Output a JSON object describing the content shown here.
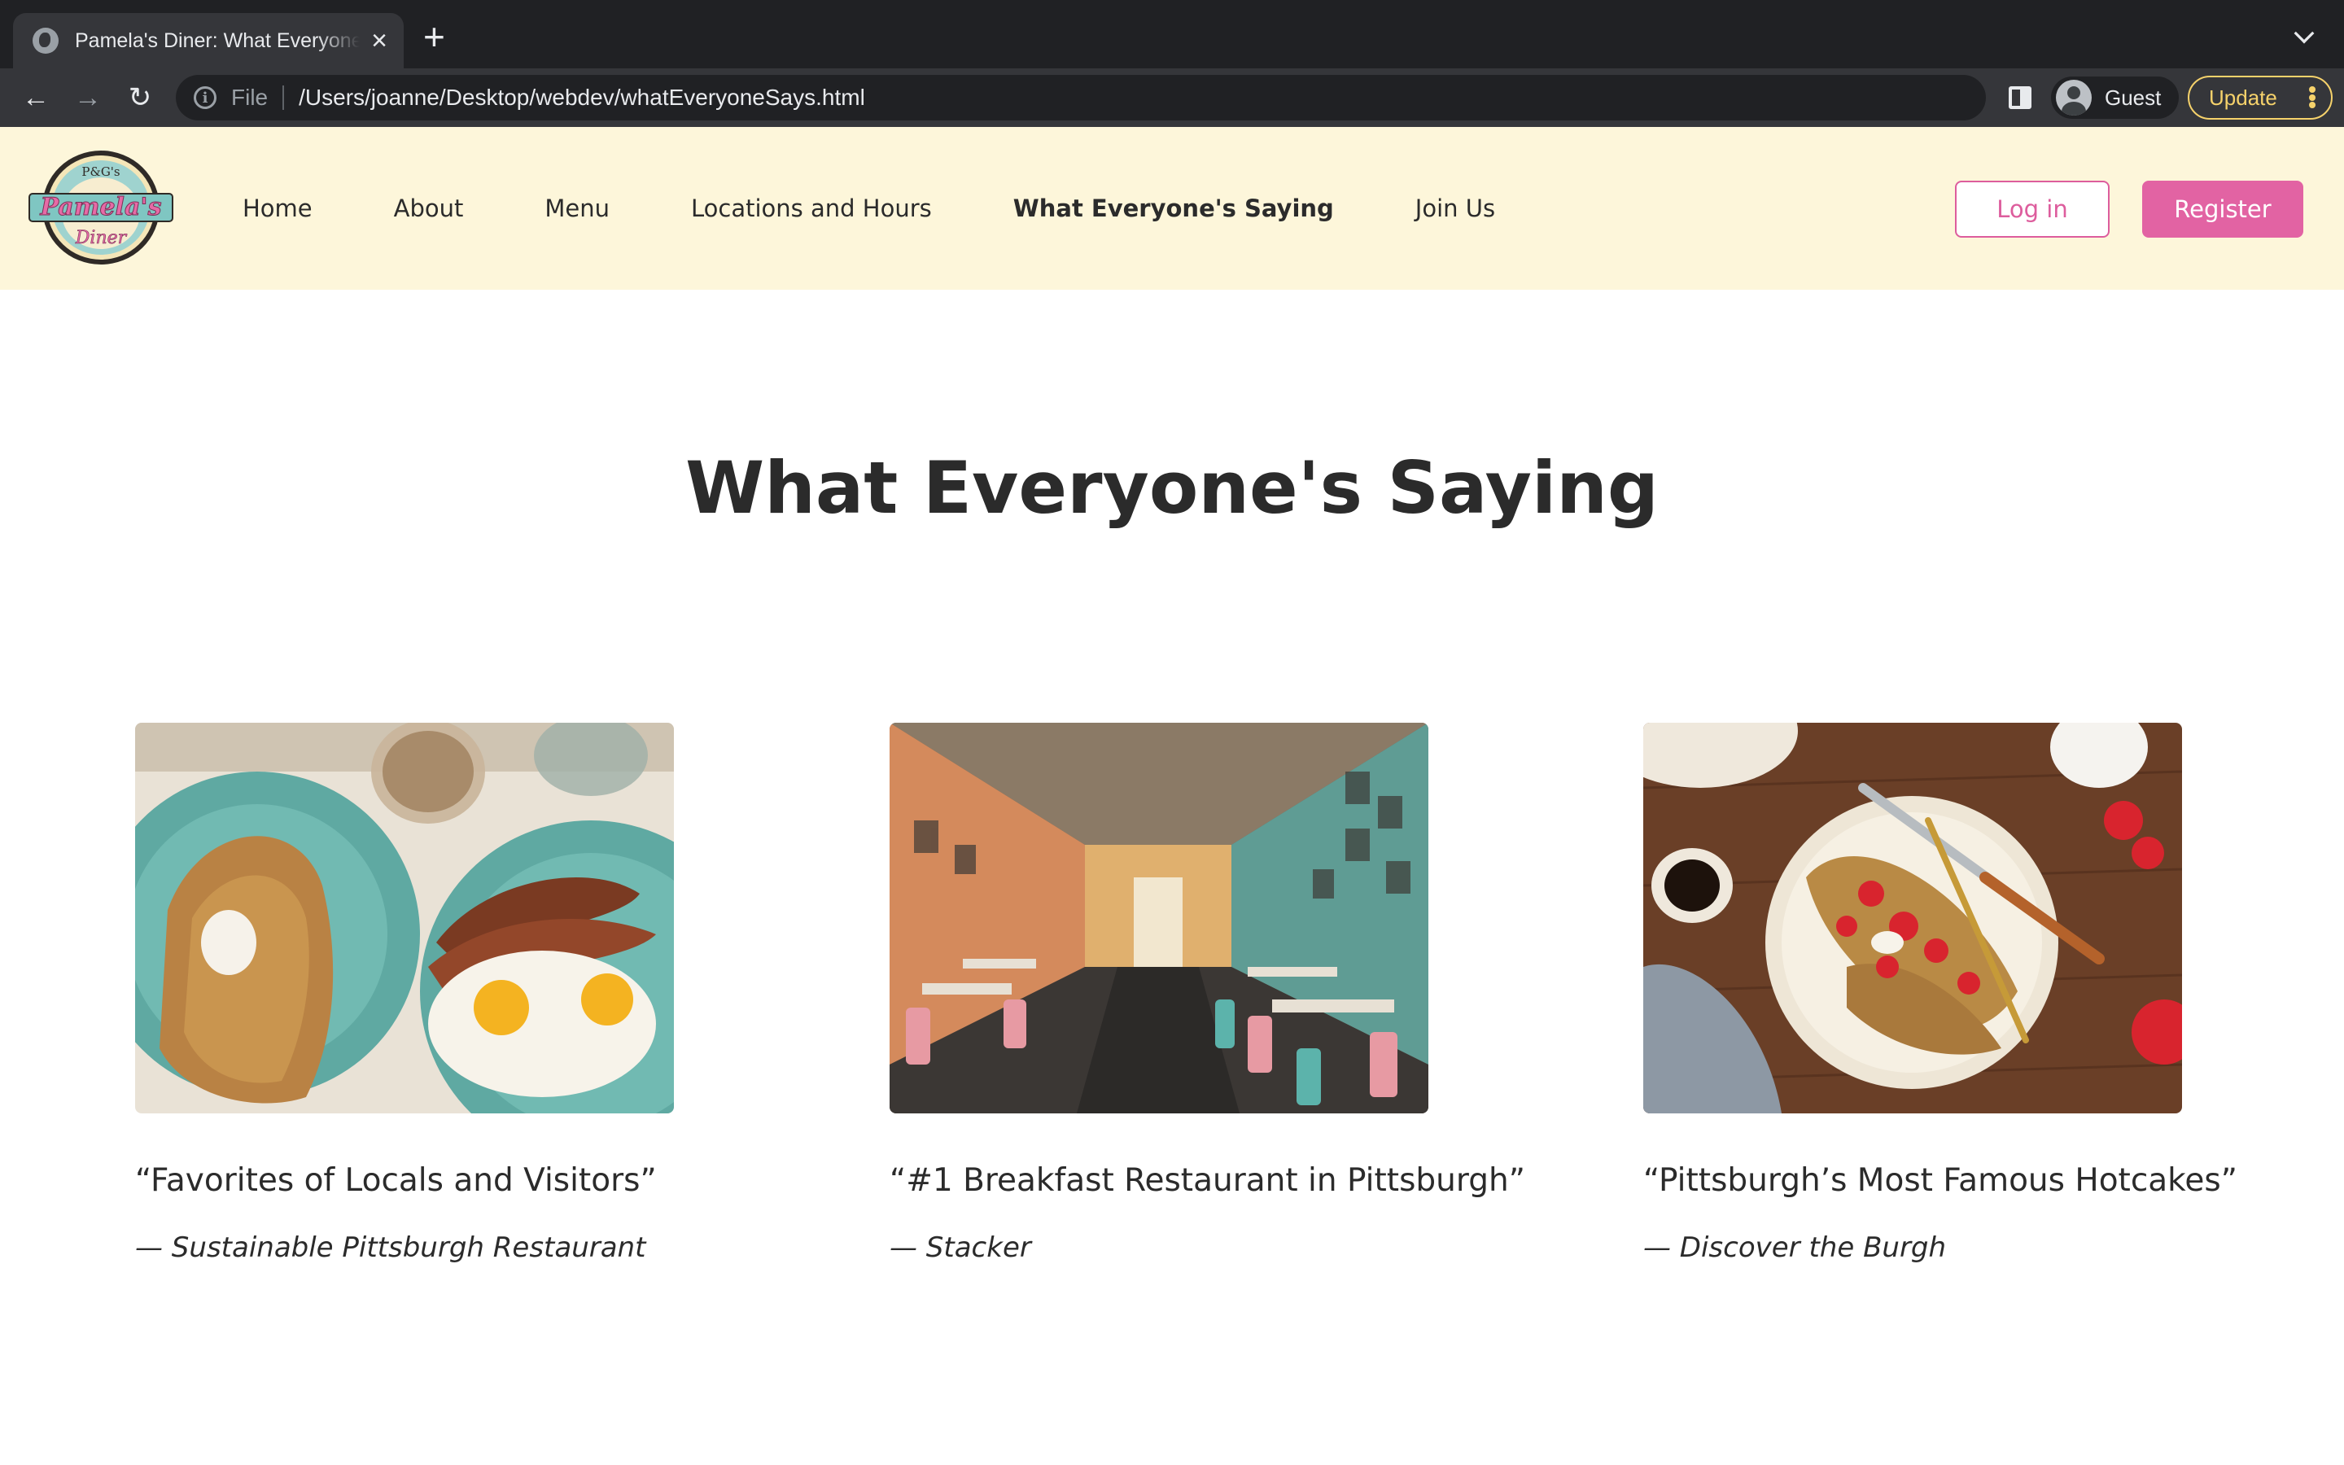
{
  "browser": {
    "tab_title": "Pamela's Diner: What Everyone's Saying",
    "tab_close": "×",
    "new_tab": "+",
    "back": "←",
    "forward": "→",
    "reload": "↻",
    "info": "i",
    "scheme_label": "File",
    "url": "/Users/joanne/Desktop/webdev/whatEveryoneSays.html",
    "profile_name": "Guest",
    "update_label": "Update",
    "update_menu": "⋮",
    "accent_color": "#f6d26b"
  },
  "header": {
    "logo": {
      "top_text": "P&G's",
      "name": "Pamela's",
      "sub": "Diner"
    },
    "nav": [
      {
        "label": "Home"
      },
      {
        "label": "About"
      },
      {
        "label": "Menu"
      },
      {
        "label": "Locations and Hours"
      },
      {
        "label": "What Everyone's Saying",
        "active": true
      },
      {
        "label": "Join Us"
      }
    ],
    "login_label": "Log in",
    "register_label": "Register",
    "brand_color": "#e263a3",
    "background_color": "#fdf6da"
  },
  "main": {
    "title": "What Everyone's Saying",
    "testimonials": [
      {
        "quote": "“Favorites of Locals and Visitors”",
        "source": "— Sustainable Pittsburgh Restaurant",
        "image": "photo-hotcakes-bacon-eggs"
      },
      {
        "quote": "“#1 Breakfast Restaurant in Pittsburgh”",
        "source": "— Stacker",
        "image": "photo-diner-interior"
      },
      {
        "quote": "“Pittsburgh’s Most Famous Hotcakes”",
        "source": "— Discover the Burgh",
        "image": "photo-crepe-strawberries"
      }
    ]
  }
}
